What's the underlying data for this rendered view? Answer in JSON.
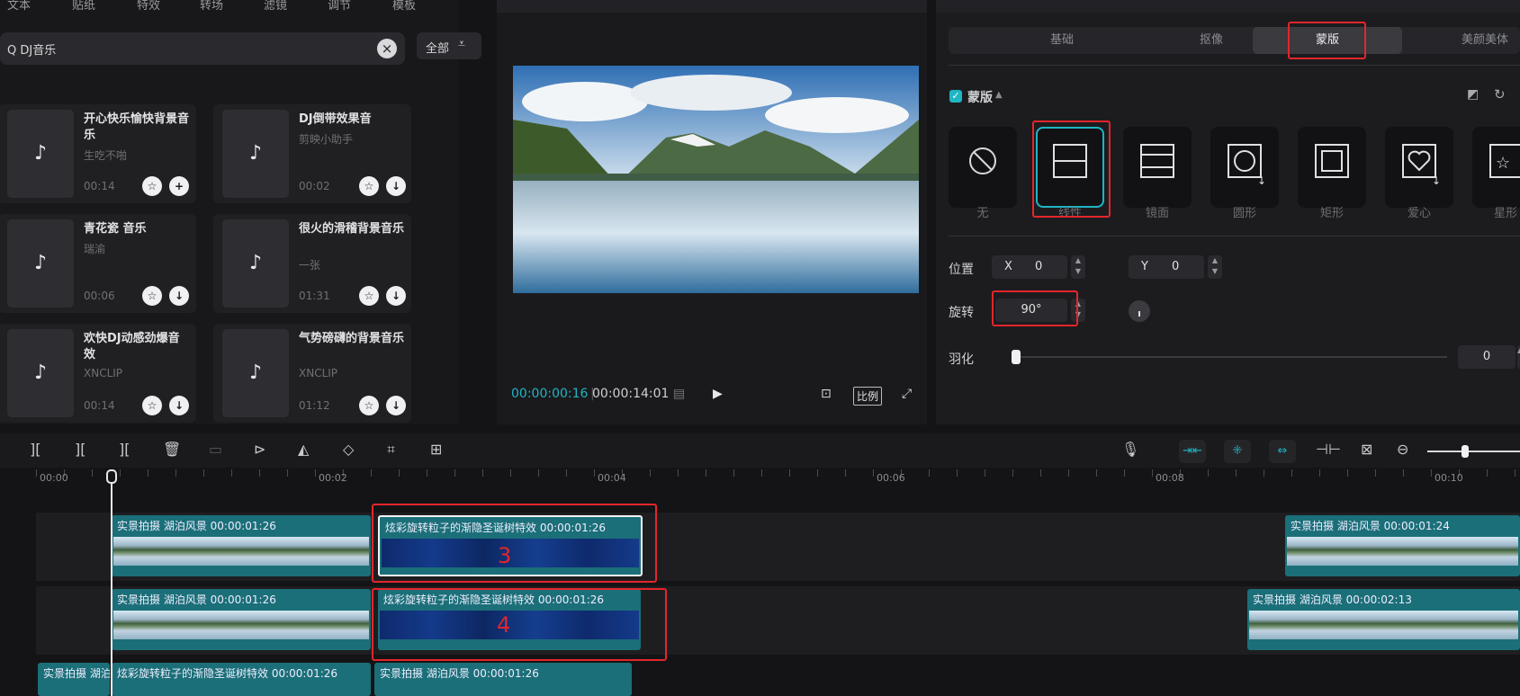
{
  "library": {
    "tabs": [
      "文本",
      "贴纸",
      "特效",
      "转场",
      "滤镜",
      "调节",
      "模板"
    ],
    "search_value": "DJ音乐",
    "filter_label": "全部",
    "items": [
      {
        "title": "开心快乐愉快背景音乐",
        "author": "生吃不啪",
        "duration": "00:14",
        "action": "+"
      },
      {
        "title": "DJ倒带效果音",
        "author": "剪映小助手",
        "duration": "00:02",
        "action": "↓"
      },
      {
        "title": "青花瓷 音乐",
        "author": "瑞渝",
        "duration": "00:06",
        "action": "↓"
      },
      {
        "title": "很火的滑稽背景音乐",
        "author": "一张",
        "duration": "01:31",
        "action": "↓"
      },
      {
        "title": "欢快DJ动感劲爆音效",
        "author": "XNCLIP",
        "duration": "00:14",
        "action": "↓"
      },
      {
        "title": "气势磅礴的背景音乐",
        "author": "XNCLIP",
        "duration": "01:12",
        "action": "↓"
      }
    ]
  },
  "preview": {
    "current_time": "00:00:00:16",
    "total_time": "00:00:14:01",
    "ratio_label": "比例"
  },
  "props": {
    "tabs": [
      "基础",
      "抠像",
      "蒙版",
      "美颜美体"
    ],
    "active_tab": "蒙版",
    "section_label": "蒙版",
    "masks": [
      "无",
      "线性",
      "镜面",
      "圆形",
      "矩形",
      "爱心",
      "星形"
    ],
    "selected_mask": "线性",
    "position_label": "位置",
    "x_label": "X",
    "x_value": "0",
    "y_label": "Y",
    "y_value": "0",
    "rotate_label": "旋转",
    "rotate_value": "90°",
    "feather_label": "羽化",
    "feather_value": "0"
  },
  "timeline": {
    "ruler": [
      "00:00",
      "00:02",
      "00:04",
      "00:06",
      "00:08",
      "00:10"
    ],
    "annotations": [
      "3",
      "4"
    ],
    "clips": [
      {
        "label": "实景拍摄 湖泊风景",
        "time": "00:00:01:26"
      },
      {
        "label": "炫彩旋转粒子的渐隐圣诞树特效",
        "time": "00:00:01:26"
      },
      {
        "label": "实景拍摄 湖泊风景",
        "time": "00:00:01:24"
      },
      {
        "label": "实景拍摄 湖泊风景",
        "time": "00:00:01:26"
      },
      {
        "label": "炫彩旋转粒子的渐隐圣诞树特效",
        "time": "00:00:01:26"
      },
      {
        "label": "实景拍摄 湖泊风景",
        "time": "00:00:02:13"
      },
      {
        "label": "实景拍摄 湖泊",
        "time": ""
      },
      {
        "label": "炫彩旋转粒子的渐隐圣诞树特效",
        "time": "00:00:01:26"
      },
      {
        "label": "实景拍摄 湖泊风景",
        "time": "00:00:01:26"
      }
    ]
  }
}
